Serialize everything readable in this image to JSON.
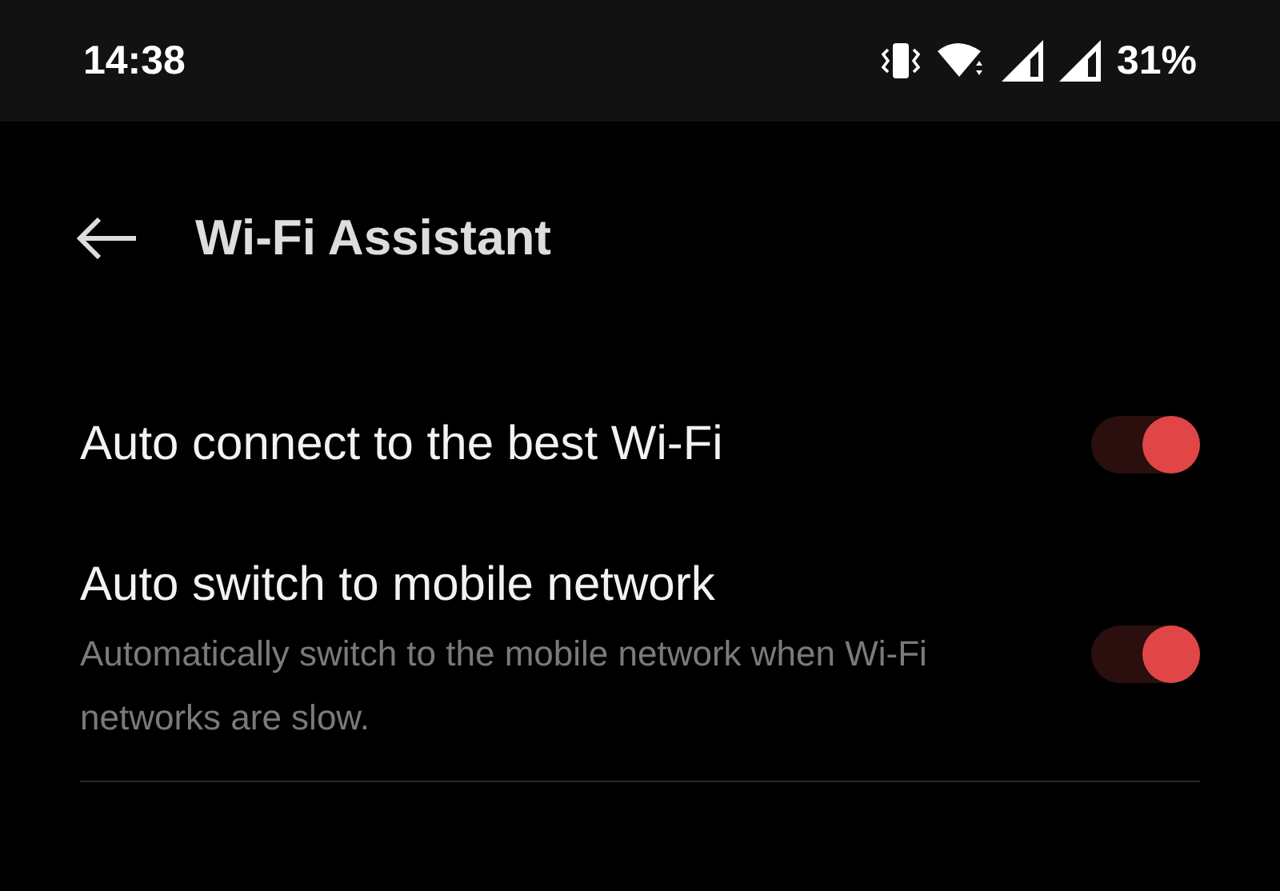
{
  "status_bar": {
    "time": "14:38",
    "battery": "31%"
  },
  "header": {
    "title": "Wi-Fi Assistant"
  },
  "settings": [
    {
      "title": "Auto connect to the best Wi-Fi",
      "on": true
    },
    {
      "title": "Auto switch to mobile network",
      "description": "Automatically switch to the mobile network when Wi-Fi networks are slow.",
      "on": true
    }
  ]
}
